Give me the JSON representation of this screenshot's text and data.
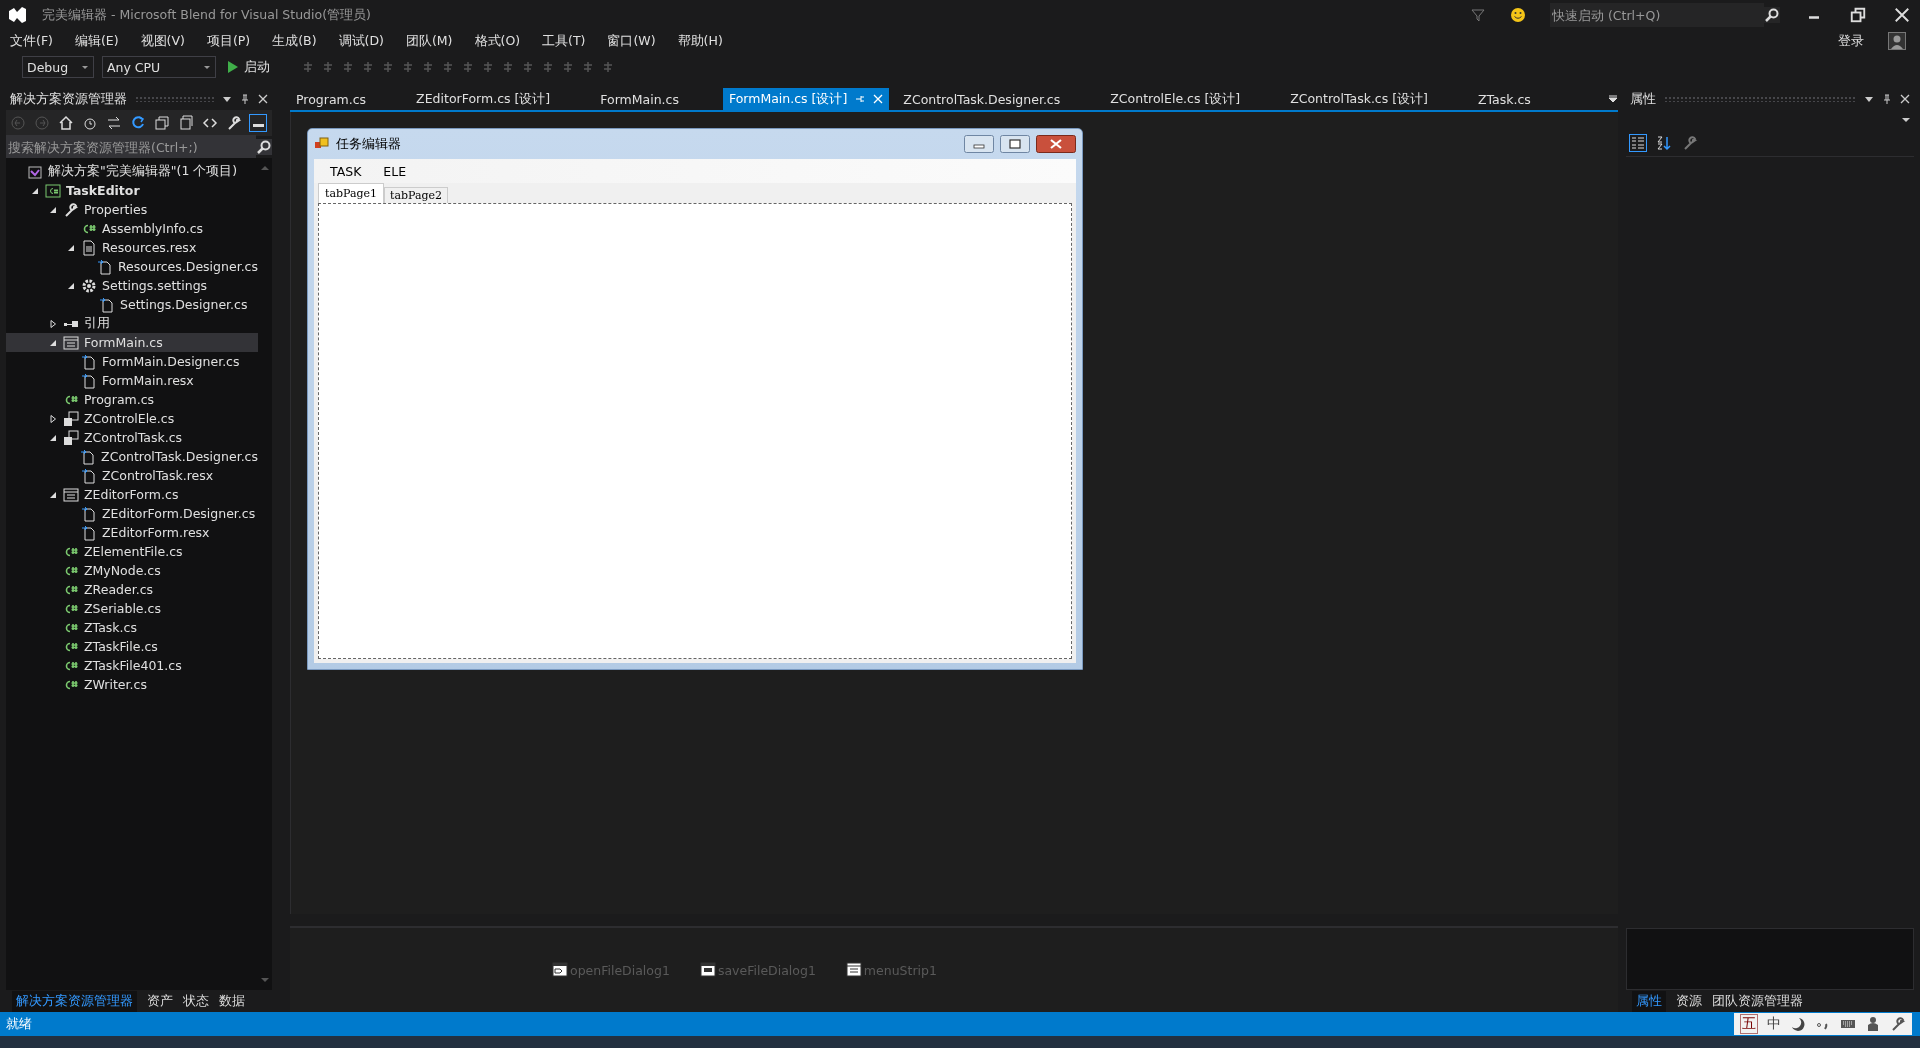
{
  "window": {
    "title": "完美编辑器 - Microsoft Blend for Visual Studio(管理员)",
    "quick_launch": {
      "placeholder": "快速启动 (Ctrl+Q)"
    },
    "sign_in": "登录"
  },
  "menu": [
    "文件(F)",
    "编辑(E)",
    "视图(V)",
    "项目(P)",
    "生成(B)",
    "调试(D)",
    "团队(M)",
    "格式(O)",
    "工具(T)",
    "窗口(W)",
    "帮助(H)"
  ],
  "toolbar": {
    "configuration": "Debug",
    "platform": "Any CPU",
    "start": "启动"
  },
  "solution_explorer": {
    "title": "解决方案资源管理器",
    "search": {
      "placeholder": "搜索解决方案资源管理器(Ctrl+;)"
    },
    "tree": [
      {
        "label": "解决方案\"完美编辑器\"(1 个项目)",
        "kind": "solution",
        "selected": false,
        "children": [
          {
            "label": "TaskEditor",
            "kind": "project",
            "bold": true,
            "expanded": true,
            "selected": false,
            "children": [
              {
                "label": "Properties",
                "kind": "wrench",
                "expanded": true,
                "selected": false,
                "children": [
                  {
                    "label": "AssemblyInfo.cs",
                    "kind": "csharp",
                    "selected": false
                  },
                  {
                    "label": "Resources.resx",
                    "kind": "resx",
                    "expanded": true,
                    "selected": false,
                    "children": [
                      {
                        "label": "Resources.Designer.cs",
                        "kind": "designer",
                        "selected": false
                      }
                    ]
                  },
                  {
                    "label": "Settings.settings",
                    "kind": "gear",
                    "expanded": true,
                    "selected": false,
                    "children": [
                      {
                        "label": "Settings.Designer.cs",
                        "kind": "designer",
                        "selected": false
                      }
                    ]
                  }
                ]
              },
              {
                "label": "引用",
                "kind": "references",
                "expanded": false,
                "selected": false
              },
              {
                "label": "FormMain.cs",
                "kind": "form",
                "expanded": true,
                "selected": true,
                "children": [
                  {
                    "label": "FormMain.Designer.cs",
                    "kind": "designer",
                    "selected": false
                  },
                  {
                    "label": "FormMain.resx",
                    "kind": "designer",
                    "selected": false
                  }
                ]
              },
              {
                "label": "Program.cs",
                "kind": "csharp",
                "selected": false
              },
              {
                "label": "ZControlEle.cs",
                "kind": "usercontrol",
                "expanded": false,
                "selected": false
              },
              {
                "label": "ZControlTask.cs",
                "kind": "usercontrol",
                "expanded": true,
                "selected": false,
                "children": [
                  {
                    "label": "ZControlTask.Designer.cs",
                    "kind": "designer",
                    "selected": false
                  },
                  {
                    "label": "ZControlTask.resx",
                    "kind": "designer",
                    "selected": false
                  }
                ]
              },
              {
                "label": "ZEditorForm.cs",
                "kind": "form",
                "expanded": true,
                "selected": false,
                "children": [
                  {
                    "label": "ZEditorForm.Designer.cs",
                    "kind": "designer",
                    "selected": false
                  },
                  {
                    "label": "ZEditorForm.resx",
                    "kind": "designer",
                    "selected": false
                  }
                ]
              },
              {
                "label": "ZElementFile.cs",
                "kind": "csharp",
                "selected": false
              },
              {
                "label": "ZMyNode.cs",
                "kind": "csharp",
                "selected": false
              },
              {
                "label": "ZReader.cs",
                "kind": "csharp",
                "selected": false
              },
              {
                "label": "ZSeriable.cs",
                "kind": "csharp",
                "selected": false
              },
              {
                "label": "ZTask.cs",
                "kind": "csharp",
                "selected": false
              },
              {
                "label": "ZTaskFile.cs",
                "kind": "csharp",
                "selected": false
              },
              {
                "label": "ZTaskFile401.cs",
                "kind": "csharp",
                "selected": false
              },
              {
                "label": "ZWriter.cs",
                "kind": "csharp",
                "selected": false
              }
            ]
          }
        ]
      }
    ],
    "bottom_tabs": [
      {
        "label": "解决方案资源管理器",
        "selected": true
      },
      {
        "label": "资产",
        "selected": false
      },
      {
        "label": "状态",
        "selected": false
      },
      {
        "label": "数据",
        "selected": false
      }
    ]
  },
  "editor_tabs": [
    {
      "label": "Program.cs",
      "selected": false
    },
    {
      "label": "ZEditorForm.cs [设计]",
      "selected": false
    },
    {
      "label": "FormMain.cs",
      "selected": false
    },
    {
      "label": "FormMain.cs [设计]",
      "selected": true
    },
    {
      "label": "ZControlTask.Designer.cs",
      "selected": false
    },
    {
      "label": "ZControlEle.cs [设计]",
      "selected": false
    },
    {
      "label": "ZControlTask.cs [设计]",
      "selected": false
    },
    {
      "label": "ZTask.cs",
      "selected": false
    }
  ],
  "designer_form": {
    "title": "任务编辑器",
    "menu": [
      "TASK",
      "ELE"
    ],
    "tabs": [
      {
        "label": "tabPage1",
        "selected": true
      },
      {
        "label": "tabPage2",
        "selected": false
      }
    ]
  },
  "component_tray": [
    {
      "label": "openFileDialog1",
      "kind": "open"
    },
    {
      "label": "saveFileDialog1",
      "kind": "save"
    },
    {
      "label": "menuStrip1",
      "kind": "menu"
    }
  ],
  "properties_panel": {
    "title": "属性",
    "bottom_tabs": [
      {
        "label": "属性",
        "selected": true
      },
      {
        "label": "资源",
        "selected": false
      },
      {
        "label": "团队资源管理器",
        "selected": false
      }
    ]
  },
  "status_bar": {
    "text": "就绪",
    "ime": [
      "五",
      "中"
    ]
  }
}
